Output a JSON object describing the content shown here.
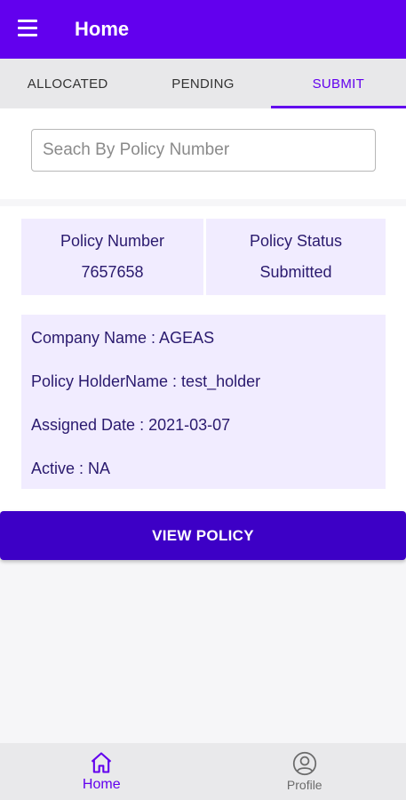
{
  "appbar": {
    "title": "Home",
    "menu_icon": "hamburger-menu-icon"
  },
  "tabs": [
    {
      "label": "ALLOCATED"
    },
    {
      "label": "PENDING"
    },
    {
      "label": "SUBMIT",
      "active": true
    }
  ],
  "search": {
    "placeholder": "Seach By Policy Number",
    "value": ""
  },
  "policy": {
    "number_label": "Policy Number",
    "number_value": "7657658",
    "status_label": "Policy Status",
    "status_value": "Submitted",
    "company": "Company Name : AGEAS",
    "holder": "Policy HolderName : test_holder",
    "assigned": "Assigned Date : 2021-03-07",
    "active": "Active : NA"
  },
  "view_button": {
    "label": "VIEW POLICY"
  },
  "bottom_nav": [
    {
      "label": "Home",
      "icon": "home-icon",
      "active": true
    },
    {
      "label": "Profile",
      "icon": "profile-icon",
      "active": false
    }
  ],
  "colors": {
    "primary": "#6200ee",
    "button": "#3d00c6",
    "panel": "#f1ecff",
    "text": "#2a1a6e"
  }
}
